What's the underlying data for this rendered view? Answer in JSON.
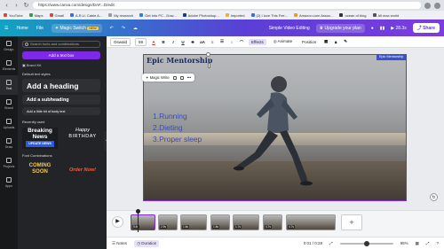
{
  "browser": {
    "url": "https://www.canva.com/design/DAF...D/edit",
    "bookmarks": [
      "YouTube",
      "Maps",
      "Gmail",
      "A.R.U. Cable A...",
      "My research",
      "Get into PC - Dow...",
      "Adobe Photoshop...",
      "Imported",
      "(2) I love This Fee...",
      "Amazon.com Assoc...",
      "ocean of blog",
      "All mac world"
    ]
  },
  "canva_topbar": {
    "home": "Home",
    "file": "File",
    "magic_switch": "Magic Switch",
    "new_badge": "NEW",
    "project_title": "Simple Video Editing",
    "upgrade": "Upgrade your plan",
    "time": "28.3s",
    "share": "Share"
  },
  "rail": [
    {
      "label": "Design",
      "icon": "design-icon"
    },
    {
      "label": "Elements",
      "icon": "elements-icon"
    },
    {
      "label": "Text",
      "icon": "text-icon"
    },
    {
      "label": "Brand",
      "icon": "brand-icon"
    },
    {
      "label": "Uploads",
      "icon": "uploads-icon"
    },
    {
      "label": "Draw",
      "icon": "draw-icon"
    },
    {
      "label": "Projects",
      "icon": "projects-icon"
    },
    {
      "label": "Apps",
      "icon": "apps-icon"
    }
  ],
  "panel": {
    "search_placeholder": "Search fonts and combinations",
    "add_text": "Add a text box",
    "brand_kit": "Brand Kit",
    "default_styles_label": "Default text styles",
    "heading": "Add a heading",
    "subheading": "Add a subheading",
    "body": "Add a little bit of body text",
    "recently_used_label": "Recently used",
    "breaking": "Breaking News",
    "breaking_sub": "UPDATE NEWS",
    "birthday_line1": "Happy",
    "birthday_line2": "BIRTHDAY",
    "combinations_label": "Font Combinations",
    "coming_soon": "COMING SOON",
    "order_now": "Order Now!"
  },
  "toolbar": {
    "font": "Oswald",
    "size": "59",
    "effects": "Effects",
    "animate": "Animate",
    "position": "Position"
  },
  "canvas": {
    "title": "Epic Mentorship",
    "list": [
      "1.Running",
      "2.Dieting",
      "3.Proper sleep"
    ],
    "label": "Epic Mentorship",
    "magic_write": "Magic Write"
  },
  "timeline": {
    "clips": [
      "5.6s",
      "2.9s",
      "1.6s",
      "1.8s",
      "1.7s",
      "4.7s",
      "4.7s"
    ]
  },
  "bottom": {
    "notes": "Notes",
    "duration": "Duration",
    "time": "0:01 / 0:28",
    "zoom": "95%"
  },
  "colors": {
    "canva_purple": "#7d2ae8",
    "title_text": "#1c2a57",
    "list_text": "#3d4bb0"
  }
}
